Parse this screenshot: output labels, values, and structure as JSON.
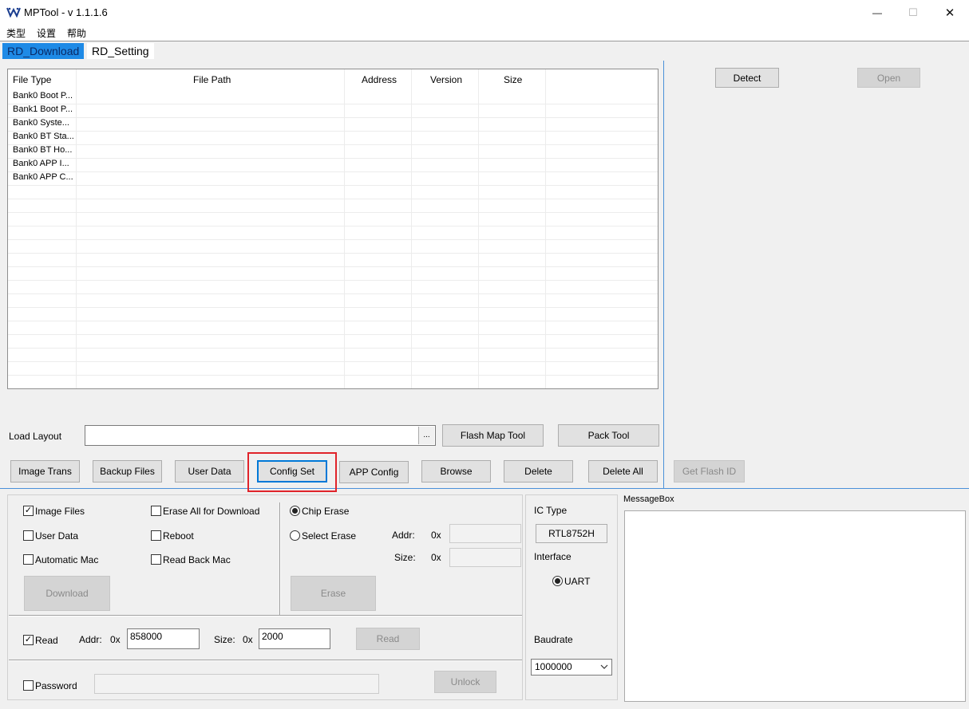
{
  "window": {
    "title": "MPTool - v 1.1.1.6",
    "minimize": "—",
    "maximize": "☐",
    "close": "✕"
  },
  "menu": [
    "类型",
    "设置",
    "帮助"
  ],
  "tabs": [
    {
      "label": "RD_Download",
      "active": true
    },
    {
      "label": "RD_Setting",
      "active": false
    }
  ],
  "table": {
    "headers": [
      "File Type",
      "File Path",
      "Address",
      "Version",
      "Size"
    ],
    "rows": [
      [
        "Bank0 Boot P...",
        "",
        "",
        "",
        ""
      ],
      [
        "Bank1 Boot P...",
        "",
        "",
        "",
        ""
      ],
      [
        "Bank0 Syste...",
        "",
        "",
        "",
        ""
      ],
      [
        "Bank0 BT Sta...",
        "",
        "",
        "",
        ""
      ],
      [
        "Bank0 BT Ho...",
        "",
        "",
        "",
        ""
      ],
      [
        "Bank0 APP I...",
        "",
        "",
        "",
        ""
      ],
      [
        "Bank0 APP C...",
        "",
        "",
        "",
        ""
      ]
    ]
  },
  "load_layout": {
    "label": "Load Layout",
    "value": "",
    "browse": "..."
  },
  "buttons": {
    "flash_map_tool": "Flash Map Tool",
    "pack_tool": "Pack Tool",
    "image_trans": "Image Trans",
    "backup_files": "Backup Files",
    "user_data": "User Data",
    "config_set": "Config Set",
    "app_config": "APP Config",
    "browse": "Browse",
    "delete": "Delete",
    "delete_all": "Delete All",
    "detect": "Detect",
    "open": "Open",
    "get_flash_id": "Get Flash ID",
    "download": "Download",
    "erase": "Erase",
    "read": "Read",
    "unlock": "Unlock"
  },
  "options": {
    "image_files": {
      "label": "Image Files",
      "checked": true
    },
    "user_data": {
      "label": "User Data",
      "checked": false
    },
    "automatic_mac": {
      "label": "Automatic Mac",
      "checked": false
    },
    "erase_all": {
      "label": "Erase All for Download",
      "checked": false
    },
    "reboot": {
      "label": "Reboot",
      "checked": false
    },
    "read_back_mac": {
      "label": "Read Back Mac",
      "checked": false
    }
  },
  "erase": {
    "chip_erase": {
      "label": "Chip Erase",
      "selected": true
    },
    "select_erase": {
      "label": "Select Erase",
      "selected": false
    },
    "addr_label": "Addr:",
    "size_label": "Size:",
    "prefix": "0x"
  },
  "read": {
    "label": "Read",
    "checked": true,
    "addr_label": "Addr:",
    "addr_prefix": "0x",
    "addr_value": "858000",
    "size_label": "Size:",
    "size_prefix": "0x",
    "size_value": "2000"
  },
  "password": {
    "label": "Password",
    "checked": false,
    "value": ""
  },
  "ic": {
    "type_label": "IC Type",
    "type_value": "RTL8752H",
    "interface_label": "Interface",
    "interface_value": "UART",
    "baudrate_label": "Baudrate",
    "baudrate_value": "1000000"
  },
  "messagebox": {
    "label": "MessageBox",
    "content": ""
  }
}
